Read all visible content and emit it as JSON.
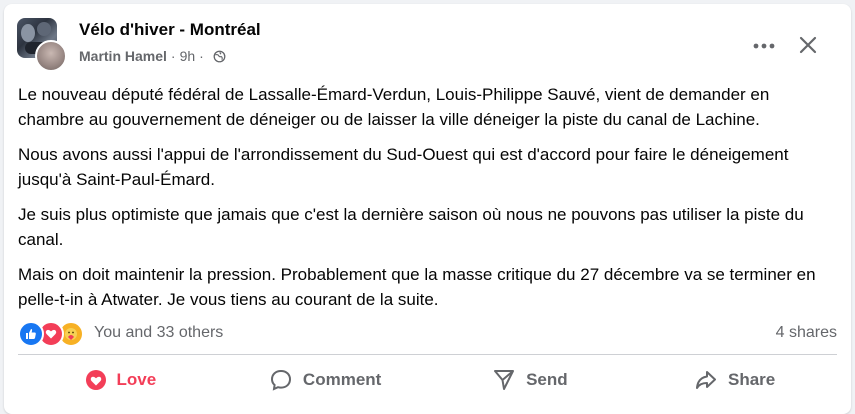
{
  "post": {
    "group_name": "Vélo d'hiver - Montréal",
    "author": "Martin Hamel",
    "separator": "·",
    "time": "9h",
    "paragraphs": [
      "Le nouveau député fédéral de Lassalle-Émard-Verdun, Louis-Philippe Sauvé, vient de demander en chambre au gouvernement de déneiger ou de laisser la ville déneiger la piste du canal de Lachine.",
      "Nous avons aussi l'appui de l'arrondissement du Sud-Ouest qui est d'accord pour faire le déneigement jusqu'à Saint-Paul-Émard.",
      "Je suis plus optimiste que jamais que c'est la dernière saison où nous ne pouvons pas utiliser la piste du canal.",
      "Mais on doit maintenir la pression. Probablement que la masse critique du 27 décembre va se terminer en pelle-t-in à Atwater. Je vous tiens au courant de la suite."
    ],
    "reactions": {
      "icons": [
        "like-icon",
        "love-icon",
        "care-icon"
      ],
      "summary": "You and 33 others",
      "shares": "4 shares"
    },
    "actions": {
      "love": "Love",
      "comment": "Comment",
      "send": "Send",
      "share": "Share"
    }
  },
  "colors": {
    "love_red": "#f33e58",
    "like_blue": "#1877f2",
    "secondary_text": "#65676b"
  }
}
